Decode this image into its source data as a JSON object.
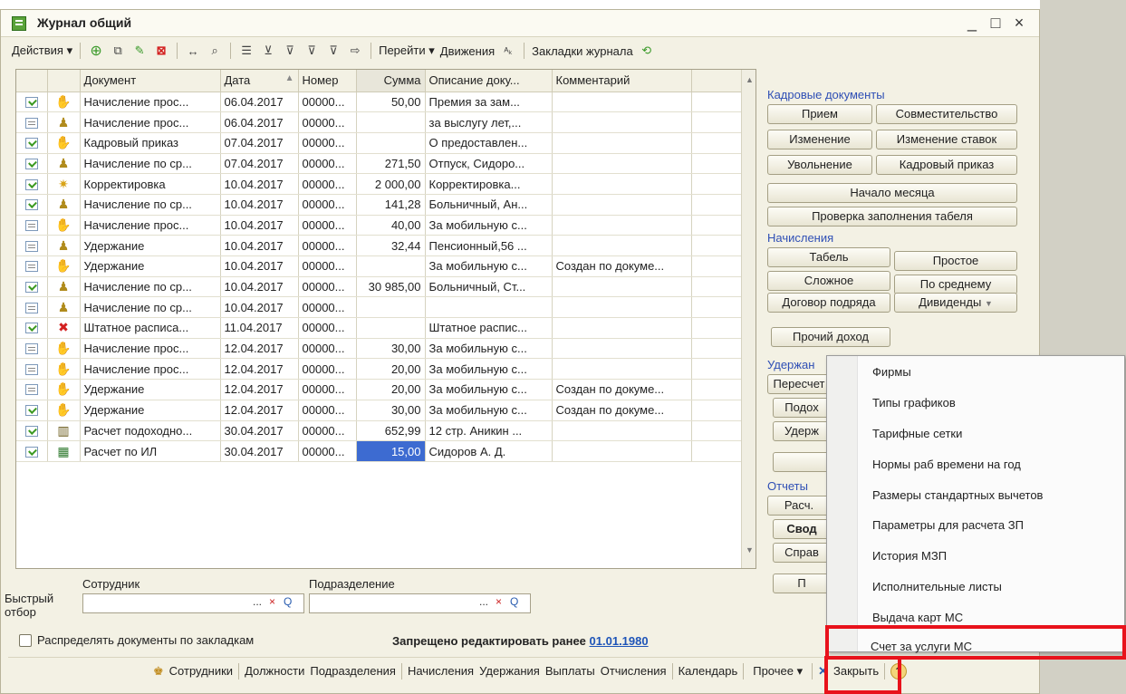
{
  "window": {
    "title": "Журнал общий",
    "controls": [
      "_",
      "□",
      "×"
    ]
  },
  "toolbar": {
    "actions": "Действия ▾",
    "goto": "Перейти ▾",
    "movements": "Движения",
    "bookmarks": "Закладки журнала"
  },
  "table": {
    "columns": [
      "Документ",
      "Дата",
      "Номер",
      "Сумма",
      "Описание доку...",
      "Комментарий"
    ],
    "rows": [
      {
        "doc": "Начисление прос...",
        "date": "06.04.2017",
        "num": "00000...",
        "sum": "50,00",
        "desc": "Премия за зам...",
        "comment": "",
        "status": "ok",
        "op": "hand"
      },
      {
        "doc": "Начисление прос...",
        "date": "06.04.2017",
        "num": "00000...",
        "sum": "",
        "desc": "за выслугу лет,...",
        "comment": "",
        "status": "plain",
        "op": "person"
      },
      {
        "doc": "Кадровый приказ",
        "date": "07.04.2017",
        "num": "00000...",
        "sum": "",
        "desc": "О предоставлен...",
        "comment": "",
        "status": "ok",
        "op": "hand"
      },
      {
        "doc": "Начисление по ср...",
        "date": "07.04.2017",
        "num": "00000...",
        "sum": "271,50",
        "desc": "Отпуск, Сидоро...",
        "comment": "",
        "status": "ok",
        "op": "person"
      },
      {
        "doc": "Корректировка",
        "date": "10.04.2017",
        "num": "00000...",
        "sum": "2 000,00",
        "desc": " Корректировка...",
        "comment": "",
        "status": "ok",
        "op": "star"
      },
      {
        "doc": "Начисление по ср...",
        "date": "10.04.2017",
        "num": "00000...",
        "sum": "141,28",
        "desc": "Больничный, Ан...",
        "comment": "",
        "status": "ok",
        "op": "person"
      },
      {
        "doc": "Начисление прос...",
        "date": "10.04.2017",
        "num": "00000...",
        "sum": "40,00",
        "desc": "За мобильную с...",
        "comment": "",
        "status": "plain",
        "op": "hand"
      },
      {
        "doc": "Удержание",
        "date": "10.04.2017",
        "num": "00000...",
        "sum": "32,44",
        "desc": "Пенсионный,56 ...",
        "comment": "",
        "status": "plain",
        "op": "person"
      },
      {
        "doc": "Удержание",
        "date": "10.04.2017",
        "num": "00000...",
        "sum": "",
        "desc": "За мобильную с...",
        "comment": "Создан по докуме...",
        "status": "plain",
        "op": "hand"
      },
      {
        "doc": "Начисление по ср...",
        "date": "10.04.2017",
        "num": "00000...",
        "sum": "30 985,00",
        "desc": "Больничный, Ст...",
        "comment": "",
        "status": "ok",
        "op": "person"
      },
      {
        "doc": "Начисление по ср...",
        "date": "10.04.2017",
        "num": "00000...",
        "sum": "",
        "desc": "",
        "comment": "",
        "status": "plain",
        "op": "person"
      },
      {
        "doc": "Штатное расписа...",
        "date": "11.04.2017",
        "num": "00000...",
        "sum": "",
        "desc": "Штатное распис...",
        "comment": "",
        "status": "ok",
        "op": "x"
      },
      {
        "doc": "Начисление прос...",
        "date": "12.04.2017",
        "num": "00000...",
        "sum": "30,00",
        "desc": "За мобильную с...",
        "comment": "",
        "status": "plain",
        "op": "hand"
      },
      {
        "doc": "Начисление прос...",
        "date": "12.04.2017",
        "num": "00000...",
        "sum": "20,00",
        "desc": "За мобильную с...",
        "comment": "",
        "status": "plain",
        "op": "hand"
      },
      {
        "doc": "Удержание",
        "date": "12.04.2017",
        "num": "00000...",
        "sum": "20,00",
        "desc": "За мобильную с...",
        "comment": "Создан по докуме...",
        "status": "plain",
        "op": "hand"
      },
      {
        "doc": "Удержание",
        "date": "12.04.2017",
        "num": "00000...",
        "sum": "30,00",
        "desc": "За мобильную с...",
        "comment": "Создан по докуме...",
        "status": "ok",
        "op": "hand"
      },
      {
        "doc": "Расчет подоходно...",
        "date": "30.04.2017",
        "num": "00000...",
        "sum": "652,99",
        "desc": "12 стр. Аникин ...",
        "comment": "",
        "status": "ok",
        "op": "chart"
      },
      {
        "doc": "Расчет по ИЛ",
        "date": "30.04.2017",
        "num": "00000...",
        "sum": "15,00",
        "desc": "Сидоров А. Д.",
        "comment": "",
        "status": "ok",
        "op": "calc"
      }
    ]
  },
  "filter": {
    "quick_label": "Быстрый отбор",
    "employee_label": "Сотрудник",
    "division_label": "Подразделение",
    "btn_dots": "...",
    "btn_clear": "×",
    "btn_search": "Q"
  },
  "distribute_label": "Распределять документы по закладкам",
  "ban": {
    "text": "Запрещено редактировать ранее",
    "date": "01.01.1980"
  },
  "bottombar": [
    "Сотрудники",
    "Должности",
    "Подразделения",
    "Начисления",
    "Удержания",
    "Выплаты",
    "Отчисления",
    "Календарь",
    "Прочее ▾",
    "Закрыть"
  ],
  "panel": {
    "hr_title": "Кадровые документы",
    "hr_buttons": [
      "Прием",
      "Совместительство",
      "Изменение",
      "Изменение ставок",
      "Увольнение",
      "Кадровый приказ",
      "Начало месяца",
      "Проверка заполнения табеля"
    ],
    "acc_title": "Начисления",
    "acc_buttons": [
      "Табель",
      "Простое",
      "Сложное",
      "По среднему",
      "Договор подряда",
      "Дивиденды",
      "Прочий доход"
    ],
    "ded_title": "Удержан",
    "ded_buttons": [
      "Пересчет",
      "Подох",
      "Удерж"
    ],
    "rep_title": "Отчеты",
    "rep_buttons": [
      "Расч.",
      "Свод",
      "Справ",
      "П"
    ]
  },
  "menu": {
    "items": [
      "Фирмы",
      "Типы графиков",
      "Тарифные сетки",
      "Нормы раб времени на год",
      "Размеры стандартных вычетов",
      "Параметры для расчета ЗП",
      "История МЗП",
      "Исполнительные листы",
      "Выдача карт МС",
      "Счет за услуги МС"
    ]
  },
  "colors": {
    "highlight": "#e8121b",
    "selected_cell": "#3d6bd1",
    "link": "#1f55b8"
  }
}
